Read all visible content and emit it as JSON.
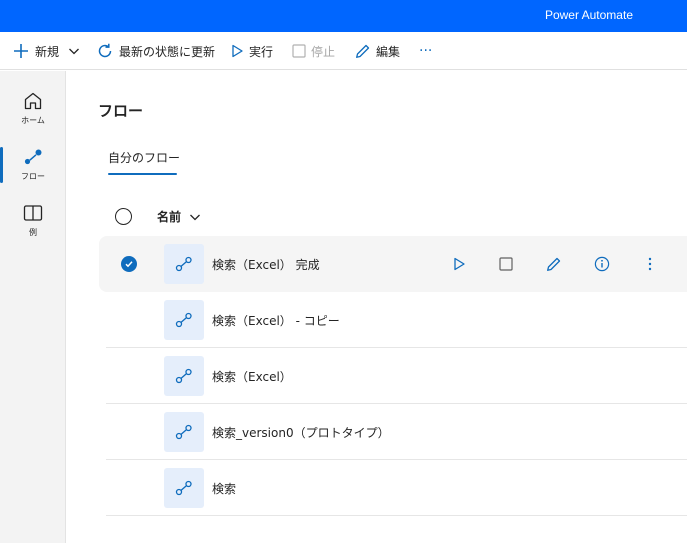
{
  "titlebar": {
    "app_title": "Power Automate"
  },
  "toolbar": {
    "new_label": "新規",
    "refresh_label": "最新の状態に更新",
    "run_label": "実行",
    "stop_label": "停止",
    "edit_label": "編集",
    "more_label": "···"
  },
  "nav": {
    "items": [
      {
        "label": "ホーム",
        "icon": "home-icon"
      },
      {
        "label": "フロー",
        "icon": "flow-icon",
        "active": true
      },
      {
        "label": "例",
        "icon": "book-icon"
      }
    ]
  },
  "page": {
    "title": "フロー",
    "tab_label": "自分のフロー"
  },
  "list": {
    "column_name": "名前",
    "rows": [
      {
        "name": "検索（Excel） 完成",
        "selected": true
      },
      {
        "name": "検索（Excel） - コピー",
        "selected": false
      },
      {
        "name": "検索（Excel）",
        "selected": false
      },
      {
        "name": "検索_version0（プロトタイプ）",
        "selected": false
      },
      {
        "name": "検索",
        "selected": false
      }
    ]
  },
  "colors": {
    "titlebar": "#0066ff",
    "accent": "#0f6cbd",
    "icon_tile": "#e5eefb"
  }
}
